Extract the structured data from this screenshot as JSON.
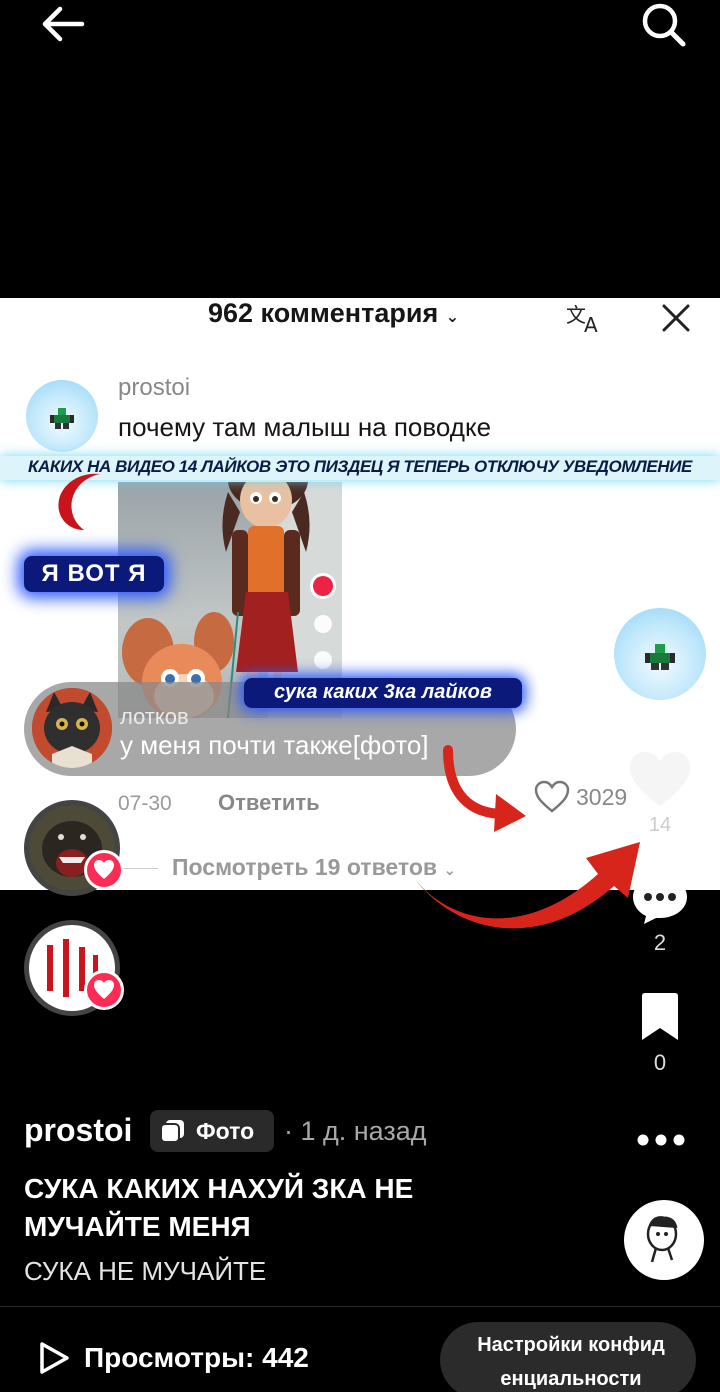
{
  "header": {
    "back_icon": "arrow-left-icon",
    "search_icon": "search-icon"
  },
  "photo": {
    "comments_header": "962 комментария",
    "comment": {
      "username": "prostoi",
      "text": "почему там малыш на поводке"
    },
    "banner_text": "КАКИХ НА ВИДЕО 14 ЛАЙКОВ ЭТО ПИЗДЕЦ Я ТЕПЕРЬ ОТКЛЮЧУ УВЕДОМЛЕНИЕ",
    "sticker_text": "Я ВОТ Я",
    "reply": {
      "username": "лотков",
      "text": "у меня почти также[фото]"
    },
    "sticker2_text": "сука каких 3ка лайков",
    "date": "07-30",
    "reply_action": "Ответить",
    "like_count": "3029",
    "view_replies": "Посмотреть 19 ответов"
  },
  "rail": {
    "like_count": "14",
    "comment_count": "2",
    "bookmark_count": "0"
  },
  "caption": {
    "username": "prostoi",
    "tag": "Фото",
    "time": "· 1 д. назад",
    "title": "СУКА КАКИХ НАХУЙ ЗКА НЕ МУЧАЙТЕ МЕНЯ",
    "description": "СУКА НЕ МУЧАЙТЕ"
  },
  "footer": {
    "views": "Просмотры: 442",
    "privacy_line1": "Настройки конфид",
    "privacy_line2": "енциальности"
  },
  "colors": {
    "accent_red": "#fe2c55",
    "arrow_red": "#d8251c",
    "sticker_blue": "#0b1a7a"
  }
}
